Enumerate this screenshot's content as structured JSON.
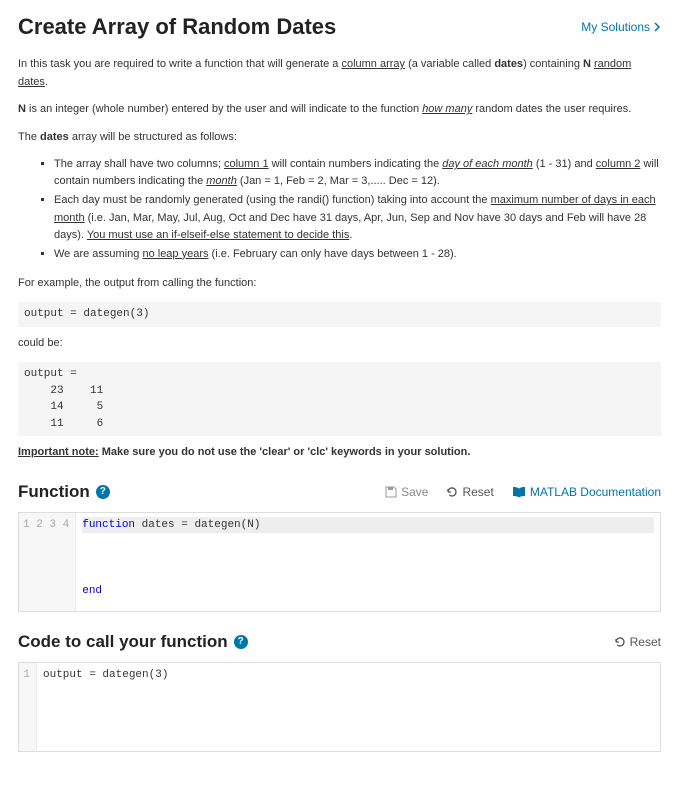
{
  "header": {
    "title": "Create Array of Random Dates",
    "mySolutions": "My Solutions"
  },
  "desc": {
    "p1_a": "In this task you are required to write a function that will generate a ",
    "p1_col": "column array",
    "p1_b": " (a variable called ",
    "p1_dates": "dates",
    "p1_c": ") containing ",
    "p1_n": "N",
    "p1_d": " ",
    "p1_rd": "random dates",
    "p1_e": ".",
    "p2_a": "N",
    "p2_b": " is an integer (whole number) entered by the user and will indicate to the function ",
    "p2_hm": "how many",
    "p2_c": " random dates the user requires.",
    "p3_a": "The ",
    "p3_dates": "dates",
    "p3_b": " array will be structured as follows:",
    "li1_a": "The array shall have two columns; ",
    "li1_c1": "column 1",
    "li1_b": " will contain numbers indicating the ",
    "li1_day": "day of each month",
    "li1_c": " (1 - 31) and ",
    "li1_c2": "column 2",
    "li1_d": " will contain numbers indicating the ",
    "li1_month": "month",
    "li1_e": " (Jan = 1, Feb = 2, Mar = 3,..... Dec = 12).",
    "li2_a": "Each day must be randomly generated (using the randi() function) taking into account the ",
    "li2_max": "maximum number of days in each month",
    "li2_b": " (i.e. Jan, Mar, May, Jul, Aug, Oct and Dec have 31 days, Apr, Jun, Sep and Nov have 30 days and Feb will have 28 days). ",
    "li2_if": "You must use an if-elseif-else statement to decide this",
    "li2_c": ".",
    "li3_a": "We are assuming ",
    "li3_nl": "no leap years",
    "li3_b": " (i.e. February can only have days between 1 - 28).",
    "p4": "For example, the output from calling the function:",
    "code1": "output = dategen(3)",
    "p5": "could be:",
    "code2": "output =\n    23    11\n    14     5\n    11     6",
    "note_u": "Important note:",
    "note_b": " Make sure you do not use the 'clear' or 'clc' keywords in your solution."
  },
  "function": {
    "title": "Function",
    "save": "Save",
    "reset": "Reset",
    "doc": "MATLAB Documentation",
    "gutter": "1\n2\n3\n4",
    "line1_kw": "function",
    "line1_rest": " dates = dategen(N)",
    "line4_kw": "end"
  },
  "caller": {
    "title": "Code to call your function",
    "reset": "Reset",
    "gutter": "1",
    "code": "output = dategen(3)"
  }
}
